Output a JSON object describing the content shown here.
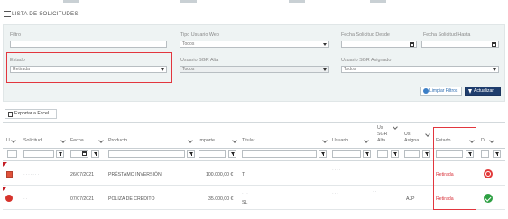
{
  "header": {
    "title": "LISTA DE SOLICITUDES"
  },
  "filters": {
    "filtro": {
      "label": "Filtro",
      "value": ""
    },
    "tipo_usuario_web": {
      "label": "Tipo Usuario Web",
      "value": "Todos"
    },
    "fecha_desde": {
      "label": "Fecha Solicitud Desde",
      "value": ""
    },
    "fecha_hasta": {
      "label": "Fecha Solicitud Hasta",
      "value": ""
    },
    "estado": {
      "label": "Estado",
      "value": "Retirada"
    },
    "usuario_sgr_alta": {
      "label": "Usuario SGR Alta",
      "value": "Todos"
    },
    "usuario_sgr_asignado": {
      "label": "Usuario SGR Asignado",
      "value": "Todos"
    },
    "clear_label": "Limpiar Filtros",
    "apply_label": "Actualizar"
  },
  "export_label": "Exportar a Excel",
  "columns": {
    "u": "U",
    "solicitud": "Solicitud",
    "fecha": "Fecha",
    "producto": "Producto",
    "importe": "Importe",
    "titular": "Titular",
    "usuario": "Usuario",
    "us_sgr_alta_1": "Us",
    "us_sgr_alta_2": "SGR",
    "us_sgr_alta_3": "Alta",
    "us_asigna_1": "Us",
    "us_asigna_2": "Asigna.",
    "estado": "Estado",
    "d": "D"
  },
  "rows": [
    {
      "solicitud": "· · · · · · ·",
      "fecha": "26/07/2021",
      "producto": "PRÉSTAMO INVERSIÓN",
      "importe": "100.000,00 €",
      "titular": "T",
      "usuario": "· · · ·",
      "us_sgr_alta": "",
      "us_asigna": "",
      "estado": "Retirada",
      "status": "retirada",
      "type_icon_color": "#e0523b"
    },
    {
      "solicitud": "· ·",
      "fecha": "07/07/2021",
      "producto": "PÓLIZA DE CRÉDITO",
      "importe": "35.000,00 €",
      "titular": "· ·  ·",
      "titular_2": "SL",
      "usuario": "· · ·",
      "us_sgr_alta": "· ·",
      "us_asigna": "AJP",
      "estado": "Retirada",
      "status": "ok",
      "type_icon_color": "#d6332c"
    }
  ],
  "colors": {
    "accent": "#1f3d6d",
    "highlight": "#e2363e",
    "retirada": "#d8323a",
    "ok": "#2ea043"
  }
}
